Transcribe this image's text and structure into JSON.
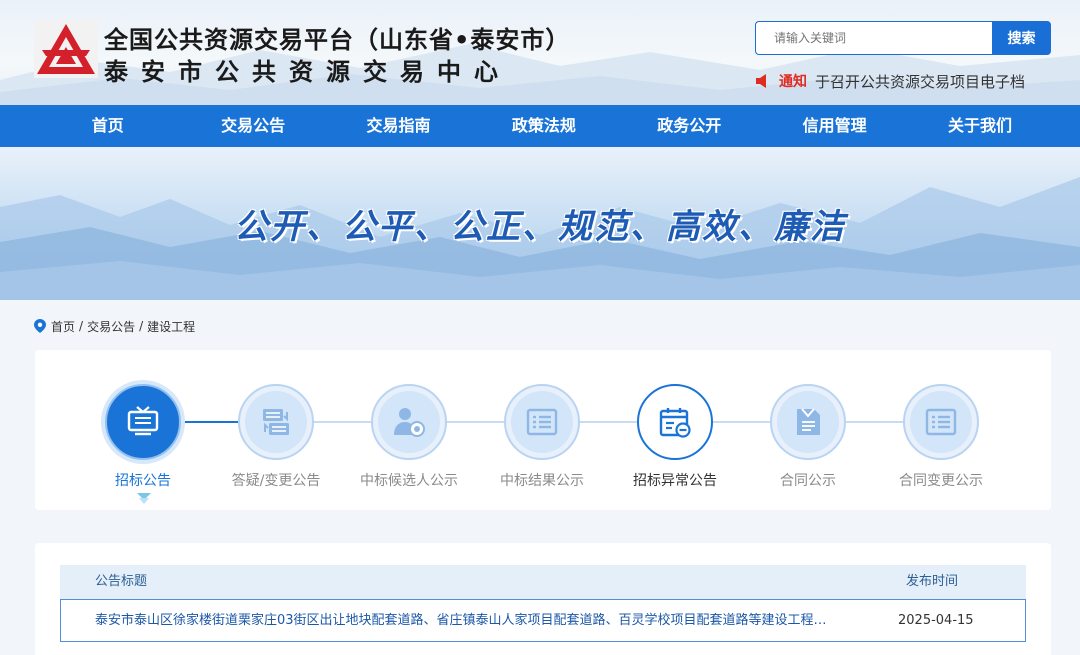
{
  "header": {
    "title": "全国公共资源交易平台（山东省•泰安市）",
    "subtitle": "泰安市公共资源交易中心",
    "search_placeholder": "请输入关键词",
    "search_button": "搜索",
    "notice_tag": "通知",
    "notice_text": "于召开公共资源交易项目电子档"
  },
  "nav": {
    "items": [
      "首页",
      "交易公告",
      "交易指南",
      "政策法规",
      "政务公开",
      "信用管理",
      "关于我们"
    ]
  },
  "banner": {
    "slogan": "公开、公平、公正、规范、高效、廉洁"
  },
  "breadcrumb": {
    "items": [
      "首页",
      "交易公告",
      "建设工程"
    ],
    "separator": "/"
  },
  "steps": {
    "items": [
      {
        "label": "招标公告",
        "icon": "billboard-icon",
        "state": "active"
      },
      {
        "label": "答疑/变更公告",
        "icon": "exchange-doc-icon",
        "state": "normal"
      },
      {
        "label": "中标候选人公示",
        "icon": "candidate-icon",
        "state": "normal"
      },
      {
        "label": "中标结果公示",
        "icon": "result-list-icon",
        "state": "normal"
      },
      {
        "label": "招标异常公告",
        "icon": "abnormal-calendar-icon",
        "state": "hover"
      },
      {
        "label": "合同公示",
        "icon": "contract-icon",
        "state": "normal"
      },
      {
        "label": "合同变更公示",
        "icon": "contract-change-icon",
        "state": "normal"
      }
    ]
  },
  "table": {
    "col_title": "公告标题",
    "col_date": "发布时间",
    "rows": [
      {
        "title": "泰安市泰山区徐家楼街道栗家庄03街区出让地块配套道路、省庄镇泰山人家项目配套道路、百灵学校项目配套道路等建设工程…",
        "date": "2025-04-15"
      }
    ]
  },
  "colors": {
    "primary": "#1a74d8",
    "notice_red": "#e02b20",
    "link_blue": "#1d58a8"
  }
}
